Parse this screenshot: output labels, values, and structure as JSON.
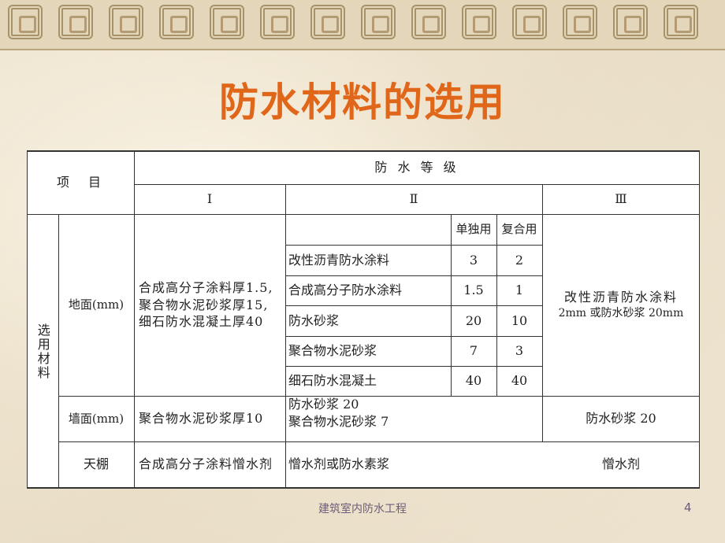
{
  "title": "防水材料的选用",
  "table": {
    "item_header": "项　目",
    "grade_header": "防 水 等 级",
    "grade_levels": [
      "Ⅰ",
      "Ⅱ",
      "Ⅲ"
    ],
    "select_materials": "选用材料",
    "sub_header": {
      "single": "单独用",
      "combined": "复合用"
    },
    "floor": {
      "label": "地面(mm)",
      "grade1": "合成高分子涂料厚1.5,聚合物水泥砂浆厚15,细石防水混凝土厚40",
      "grade2_rows": [
        {
          "name": "改性沥青防水涂料",
          "single": "3",
          "combined": "2"
        },
        {
          "name": "合成高分子防水涂料",
          "single": "1.5",
          "combined": "1"
        },
        {
          "name": "防水砂浆",
          "single": "20",
          "combined": "10"
        },
        {
          "name": "聚合物水泥砂浆",
          "single": "7",
          "combined": "3"
        },
        {
          "name": "细石防水混凝土",
          "single": "40",
          "combined": "40"
        }
      ],
      "grade3_line1": "改性沥青防水涂料",
      "grade3_line2": "2mm 或防水砂浆 20mm"
    },
    "wall": {
      "label": "墙面(mm)",
      "grade1": "聚合物水泥砂浆厚10",
      "grade2_line1": "防水砂浆 20",
      "grade2_line2": "聚合物水泥砂浆 7",
      "grade3": "防水砂浆 20"
    },
    "ceiling": {
      "label": "天棚",
      "grade1": "合成高分子涂料憎水剂",
      "grade2": "憎水剂或防水素浆",
      "grade3": "憎水剂"
    }
  },
  "footer": "建筑室内防水工程",
  "page_number": "4"
}
